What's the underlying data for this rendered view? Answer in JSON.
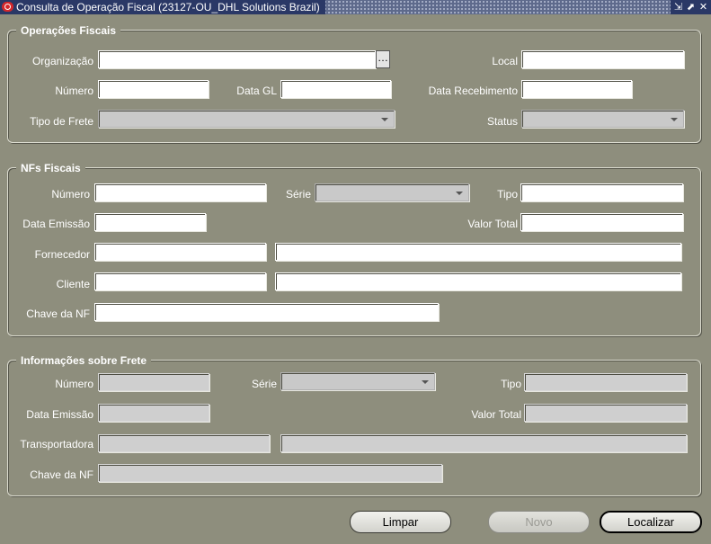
{
  "window": {
    "title": "Consulta de Operação Fiscal (23127-OU_DHL Solutions Brazil)",
    "controls": [
      "resize-icon",
      "maximize-icon",
      "close-icon"
    ]
  },
  "operacoes": {
    "legend": "Operações Fiscais",
    "organizacao_label": "Organização",
    "local_label": "Local",
    "numero_label": "Número",
    "data_gl_label": "Data GL",
    "data_recebimento_label": "Data Recebimento",
    "tipo_frete_label": "Tipo de Frete",
    "status_label": "Status",
    "lov_button": "…",
    "organizacao_value": "",
    "local_value": "",
    "numero_value": "",
    "data_gl_value": "",
    "data_recebimento_value": "",
    "tipo_frete_value": "",
    "status_value": ""
  },
  "nfs": {
    "legend": "NFs Fiscais",
    "numero_label": "Número",
    "serie_label": "Série",
    "tipo_label": "Tipo",
    "data_emissao_label": "Data Emissão",
    "valor_total_label": "Valor Total",
    "fornecedor_label": "Fornecedor",
    "cliente_label": "Cliente",
    "chave_label": "Chave da NF"
  },
  "frete": {
    "legend": "Informações sobre Frete",
    "numero_label": "Número",
    "serie_label": "Série",
    "tipo_label": "Tipo",
    "data_emissao_label": "Data Emissão",
    "valor_total_label": "Valor Total",
    "transportadora_label": "Transportadora",
    "chave_label": "Chave da NF"
  },
  "buttons": {
    "limpar": "Limpar",
    "novo": "Novo",
    "localizar": "Localizar"
  },
  "colors": {
    "background": "#8e8e7d",
    "title_bar": "#2a3866",
    "label_text": "#ffffff"
  }
}
